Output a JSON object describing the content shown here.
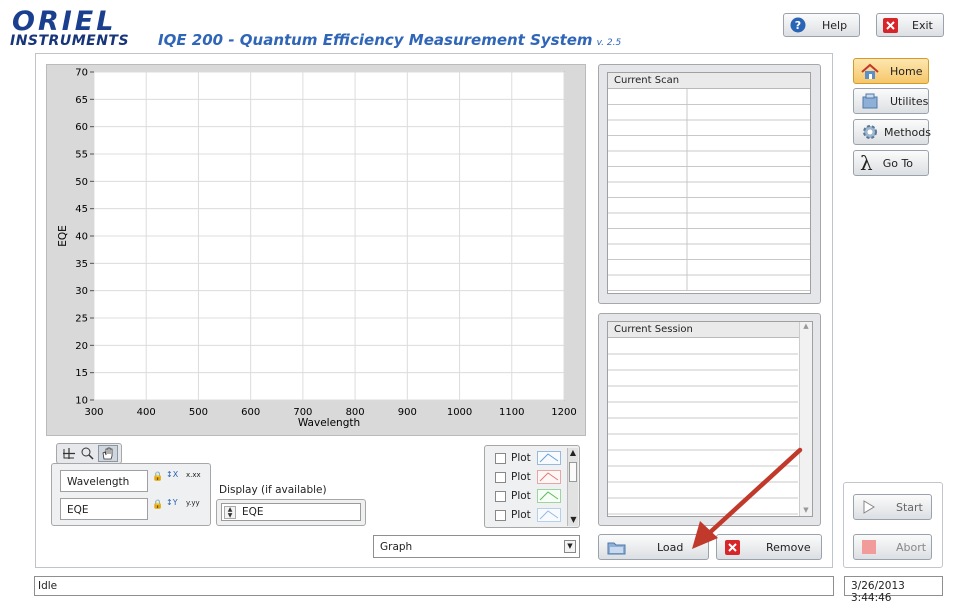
{
  "header": {
    "logo_line1": "ORIEL",
    "logo_line2": "INSTRUMENTS",
    "title": "IQE 200 - Quantum Efficiency Measurement System",
    "version": "v. 2.5",
    "help_label": "Help",
    "exit_label": "Exit"
  },
  "nav": {
    "home": "Home",
    "utilities": "Utilites",
    "methods": "Methods",
    "goto": "Go To"
  },
  "graph": {
    "scale_legend": [
      {
        "name": "Wavelength",
        "format": "x.xx"
      },
      {
        "name": "EQE",
        "format": "y.yy"
      }
    ],
    "display_label": "Display (if available)",
    "display_value": "EQE",
    "plots": [
      "Plot",
      "Plot",
      "Plot",
      "Plot"
    ],
    "view_select": "Graph"
  },
  "chart_data": {
    "type": "line",
    "xlabel": "Wavelength",
    "ylabel": "EQE",
    "xlim": [
      300,
      1200
    ],
    "ylim": [
      10,
      70
    ],
    "x_ticks": [
      "300",
      "400",
      "500",
      "600",
      "700",
      "800",
      "900",
      "1000",
      "1100",
      "1200"
    ],
    "y_ticks": [
      "10",
      "15",
      "20",
      "25",
      "30",
      "35",
      "40",
      "45",
      "50",
      "55",
      "60",
      "65",
      "70"
    ],
    "series": [],
    "grid": true
  },
  "current_scan": {
    "title": "Current Scan"
  },
  "current_session": {
    "title": "Current Session"
  },
  "actions": {
    "load": "Load",
    "remove": "Remove",
    "start": "Start",
    "abort": "Abort"
  },
  "status": {
    "text": "Idle",
    "datetime": "3/26/2013 3:44:46"
  },
  "colors": {
    "brand": "#1a3f8f",
    "title": "#2f66b7",
    "annotation_arrow": "#c0392b"
  }
}
